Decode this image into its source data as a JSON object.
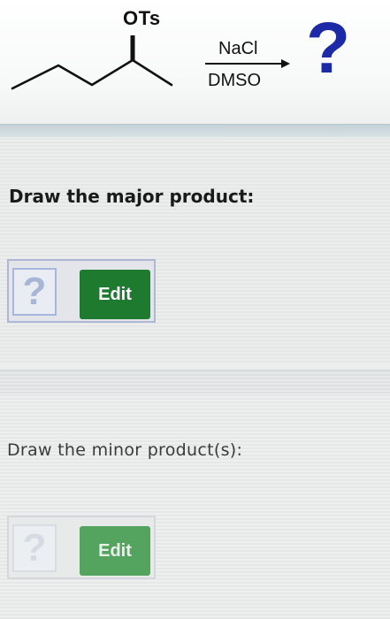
{
  "reaction": {
    "leaving_group": "OTs",
    "reagent": "NaCl",
    "solvent": "DMSO",
    "product_placeholder": "?"
  },
  "question1": {
    "prompt": "Draw the major product:",
    "placeholder": "?",
    "edit_label": "Edit"
  },
  "question2": {
    "prompt": "Draw the minor product(s):",
    "placeholder": "?",
    "edit_label": "Edit",
    "disabled": true
  },
  "colors": {
    "question_mark": "#1d2aa8",
    "edit_button": "#1e7a2e",
    "edit_button_disabled": "#54a35e"
  }
}
